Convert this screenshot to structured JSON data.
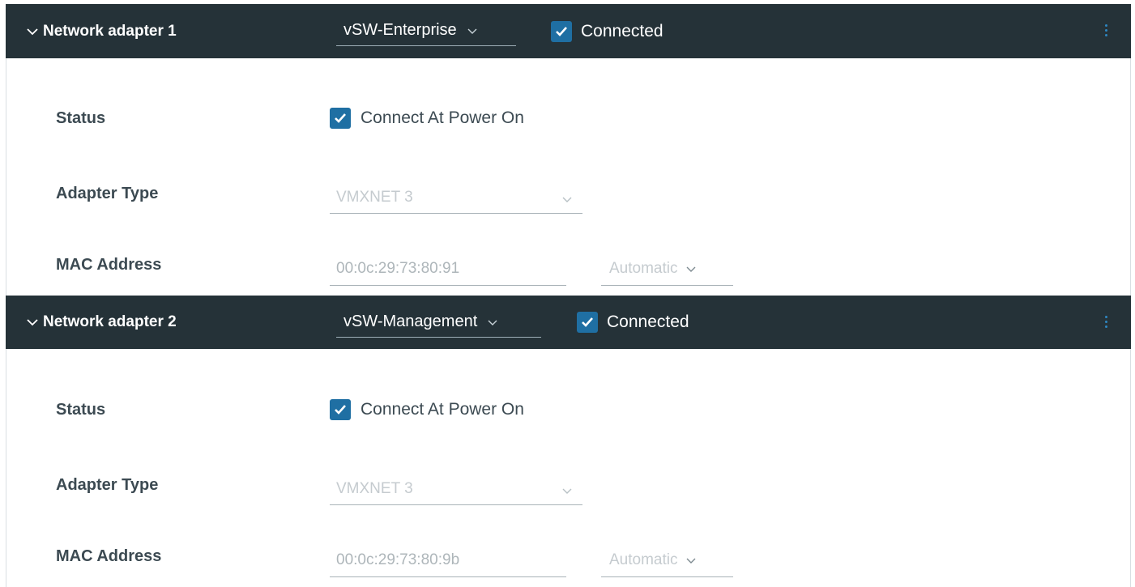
{
  "adapters": [
    {
      "title": "Network adapter 1",
      "network": "vSW-Enterprise",
      "connected_label": "Connected",
      "connected": true,
      "status_label": "Status",
      "connect_at_power_on_label": "Connect At Power On",
      "connect_at_power_on": true,
      "adapter_type_label": "Adapter Type",
      "adapter_type": "VMXNET 3",
      "mac_label": "MAC Address",
      "mac_value": "00:0c:29:73:80:91",
      "mac_mode": "Automatic"
    },
    {
      "title": "Network adapter 2",
      "network": "vSW-Management",
      "connected_label": "Connected",
      "connected": true,
      "status_label": "Status",
      "connect_at_power_on_label": "Connect At Power On",
      "connect_at_power_on": true,
      "adapter_type_label": "Adapter Type",
      "adapter_type": "VMXNET 3",
      "mac_label": "MAC Address",
      "mac_value": "00:0c:29:73:80:9b",
      "mac_mode": "Automatic"
    }
  ],
  "colors": {
    "header_bg": "#253238",
    "checkbox_bg": "#1f6fa3",
    "label_text": "#3c4a52",
    "disabled_text": "#c5cbcf",
    "kebab_accent": "#2e86c1"
  },
  "icons": {
    "collapse": "chevron-down-icon",
    "dropdown": "chevron-down-icon",
    "checkbox": "checkmark-icon",
    "menu": "kebab-menu-icon"
  }
}
